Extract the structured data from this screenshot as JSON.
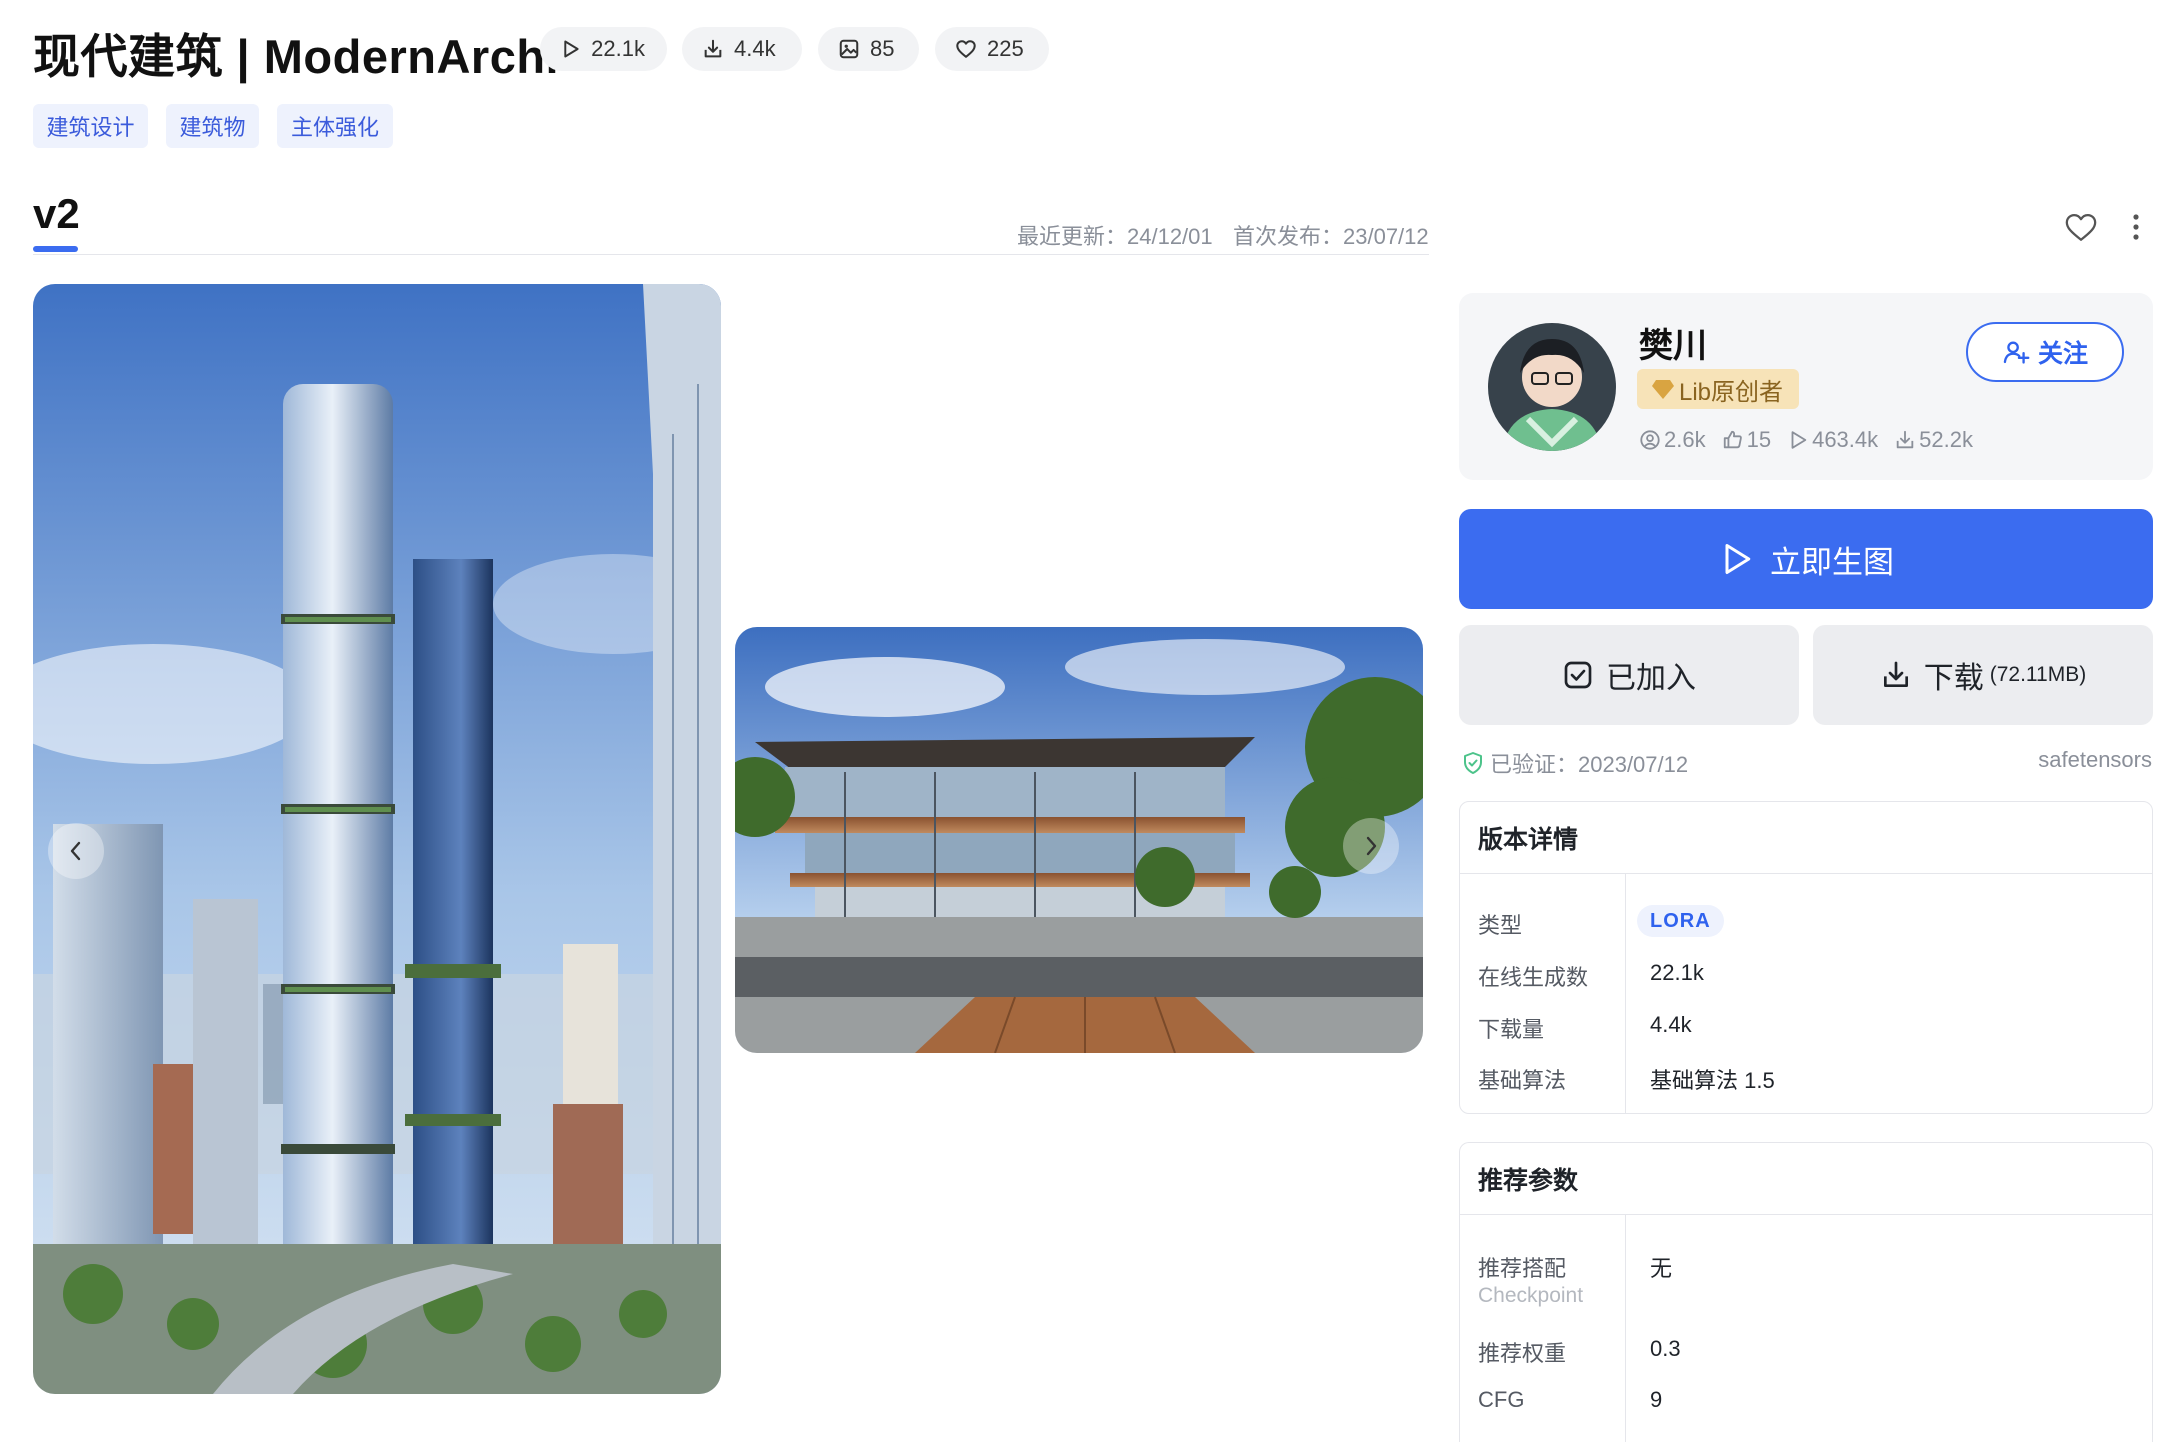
{
  "header": {
    "title": "现代建筑 | ModernArchi",
    "stats": [
      {
        "icon": "play-icon",
        "value": "22.1k"
      },
      {
        "icon": "download-icon",
        "value": "4.4k"
      },
      {
        "icon": "image-icon",
        "value": "85"
      },
      {
        "icon": "heart-icon",
        "value": "225"
      }
    ],
    "tags": [
      "建筑设计",
      "建筑物",
      "主体强化"
    ]
  },
  "version": {
    "label": "v2",
    "updated": "最近更新：24/12/01",
    "published": "首次发布：23/07/12"
  },
  "author": {
    "name": "樊川",
    "badge": "Lib原创者",
    "follow_label": "关注",
    "stats": {
      "followers": "2.6k",
      "likes": "15",
      "runs": "463.4k",
      "downloads": "52.2k"
    }
  },
  "actions": {
    "generate_label": "立即生图",
    "added_label": "已加入",
    "download_label": "下载",
    "download_size": "(72.11MB)"
  },
  "verification": {
    "text": "已验证：2023/07/12",
    "format": "safetensors"
  },
  "version_details": {
    "title": "版本详情",
    "rows": [
      {
        "label": "类型",
        "value": "LORA"
      },
      {
        "label": "在线生成数",
        "value": "22.1k"
      },
      {
        "label": "下载量",
        "value": "4.4k"
      },
      {
        "label": "基础算法",
        "value": "基础算法 1.5"
      }
    ]
  },
  "recommended": {
    "title": "推荐参数",
    "rows": [
      {
        "label": "推荐搭配",
        "sublabel": "Checkpoint",
        "value": "无"
      },
      {
        "label": "推荐权重",
        "value": "0.3"
      },
      {
        "label": "CFG",
        "value": "9"
      }
    ]
  },
  "colors": {
    "accent": "#3b6cf0",
    "tag_bg": "#eef2fd",
    "badge_bg": "#f7e3b8"
  }
}
